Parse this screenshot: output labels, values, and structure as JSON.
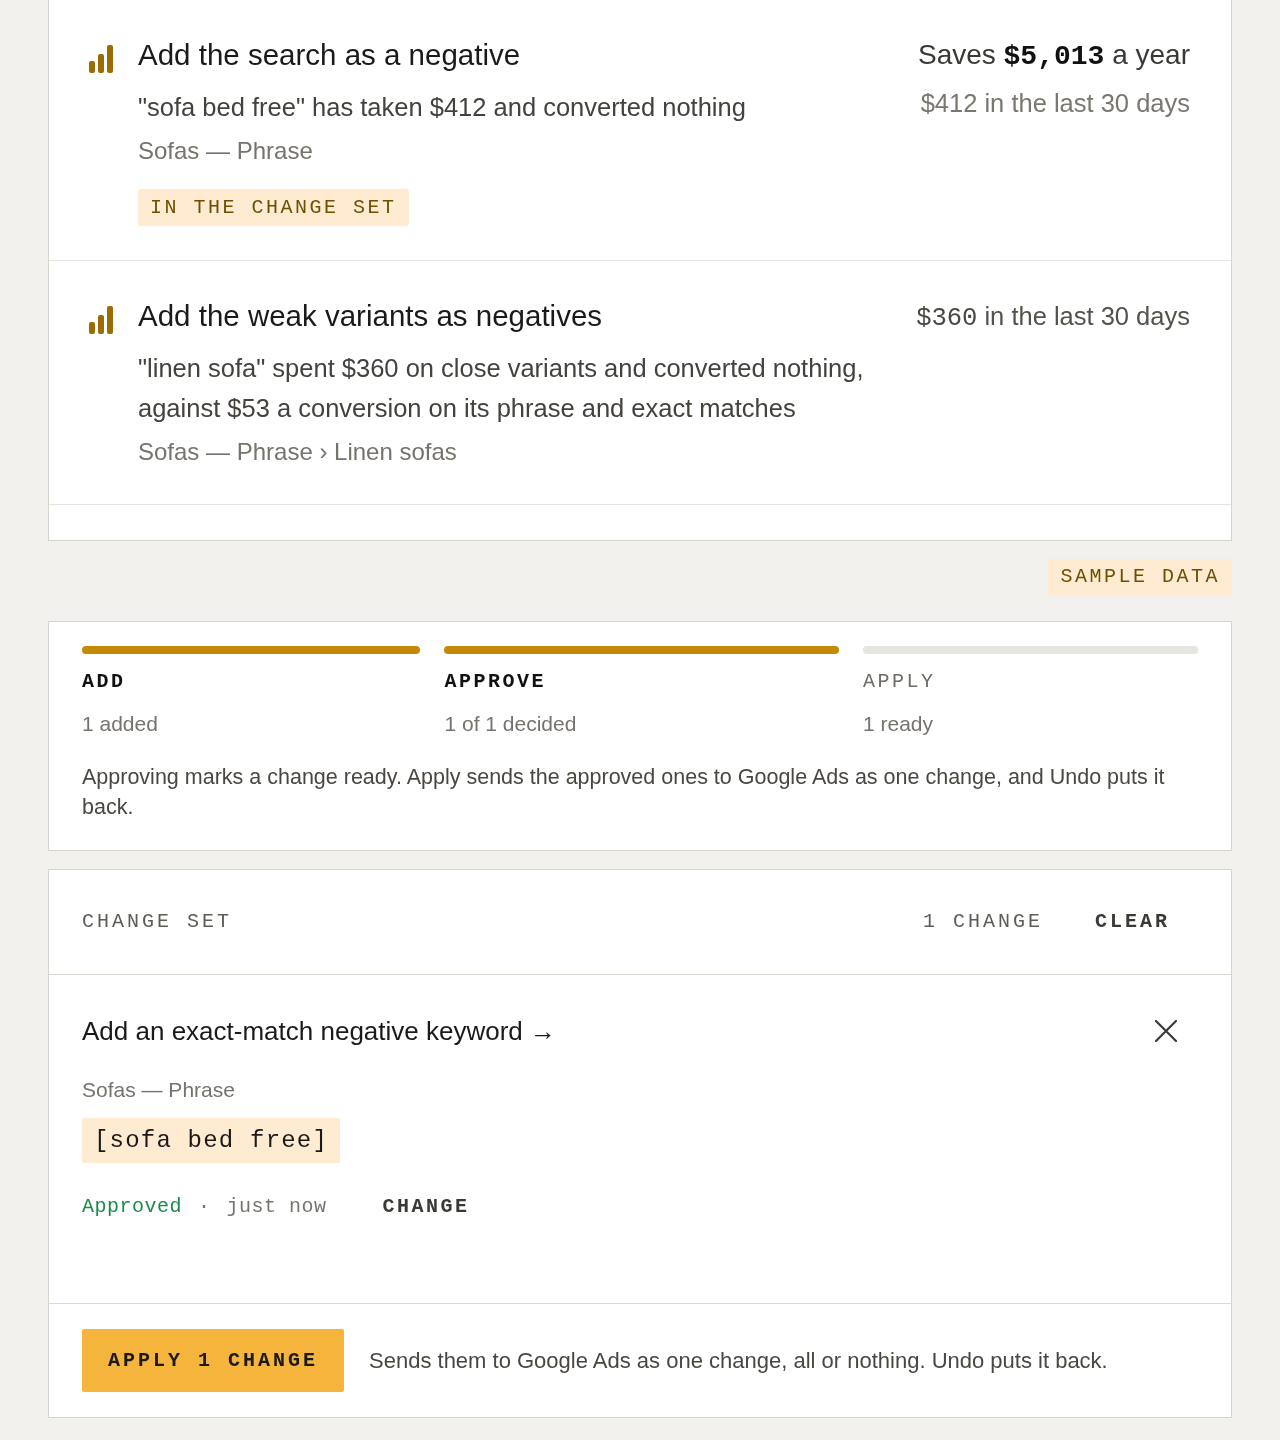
{
  "findings": [
    {
      "title": "Add the search as a negative",
      "description": "\"sofa bed free\" has taken $412 and converted nothing",
      "location": "Sofas — Phrase",
      "tag": "IN THE CHANGE SET",
      "savings": "Saves **$5,013** a year",
      "spend": "$412 in the last 30 days"
    },
    {
      "title": "Add the weak variants as negatives",
      "description": "\"linen sofa\" spent $360 on close variants and converted nothing, against $53 a conversion on its phrase and exact matches",
      "location": "Sofas — Phrase › Linen sofas",
      "spend": "**$360** in the last 30 days"
    }
  ],
  "sample_badge": "SAMPLE DATA",
  "steps": [
    {
      "label": "ADD",
      "detail": "1 added",
      "done": true
    },
    {
      "label": "APPROVE",
      "detail": "1 of 1 decided",
      "done": true
    },
    {
      "label": "APPLY",
      "detail": "1 ready",
      "done": false
    }
  ],
  "steps_note": "Approving marks a change ready. Apply sends the approved ones to Google Ads as one change, and Undo puts it back.",
  "change_set": {
    "title": "CHANGE SET",
    "count": "1 CHANGE",
    "clear_button": "CLEAR",
    "changes": [
      {
        "action": "Add an exact-match negative keyword →",
        "location": "Sofas — Phrase",
        "keyword": "[sofa bed free]",
        "status": "Approved",
        "approved": true,
        "separator": "·",
        "time": "just now",
        "change_button": "CHANGE"
      }
    ],
    "apply_button": "APPLY 1 CHANGE",
    "apply_note": "Sends them to Google Ads as one change, all or nothing. Undo puts it back."
  }
}
